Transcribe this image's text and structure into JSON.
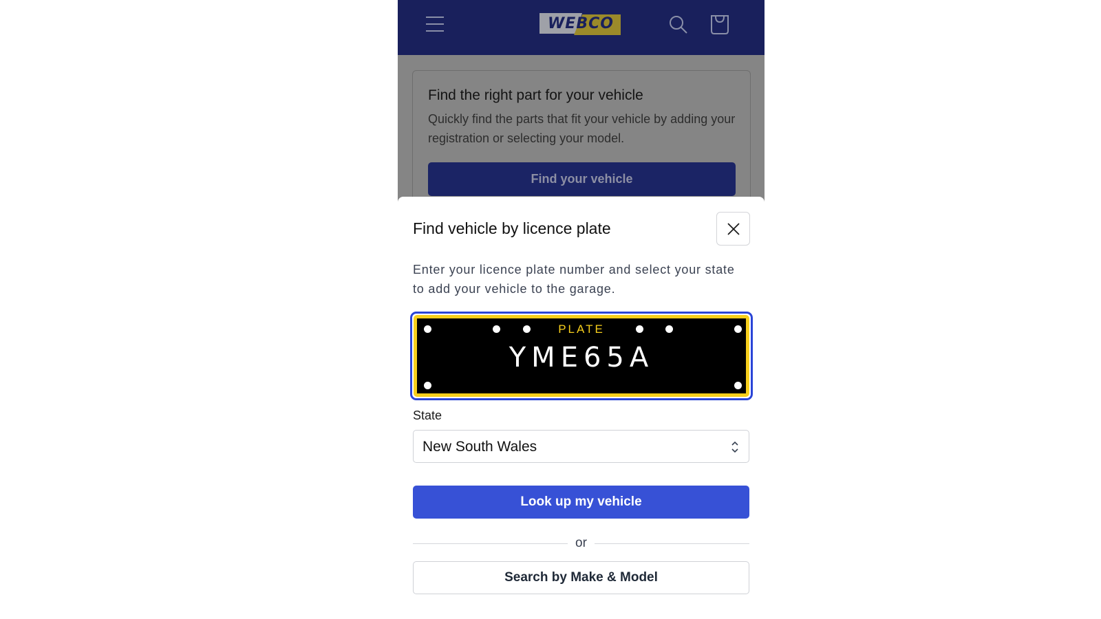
{
  "header": {
    "logo_text": "WEBCO",
    "menu_icon": "hamburger-menu-icon",
    "search_icon": "search-icon",
    "cart_icon": "shopping-bag-icon",
    "background_color": "#19205c"
  },
  "promo_card": {
    "title": "Find the right part for your vehicle",
    "description": "Quickly find the parts that fit your vehicle by adding your registration or selecting your model.",
    "button_label": "Find your vehicle"
  },
  "modal": {
    "title": "Find vehicle by licence plate",
    "close_icon": "close-icon",
    "description": "Enter your licence plate number and select your state to add your vehicle to the garage.",
    "plate": {
      "label": "PLATE",
      "value": "YME65A",
      "frame_color": "#f7cf1c",
      "focus_color": "#2a45d6"
    },
    "state": {
      "label": "State",
      "selected": "New South Wales",
      "icon": "chevron-up-down-icon"
    },
    "lookup_button_label": "Look up my vehicle",
    "divider_text": "or",
    "make_model_button_label": "Search by Make & Model",
    "accent_color": "#3751d6"
  }
}
